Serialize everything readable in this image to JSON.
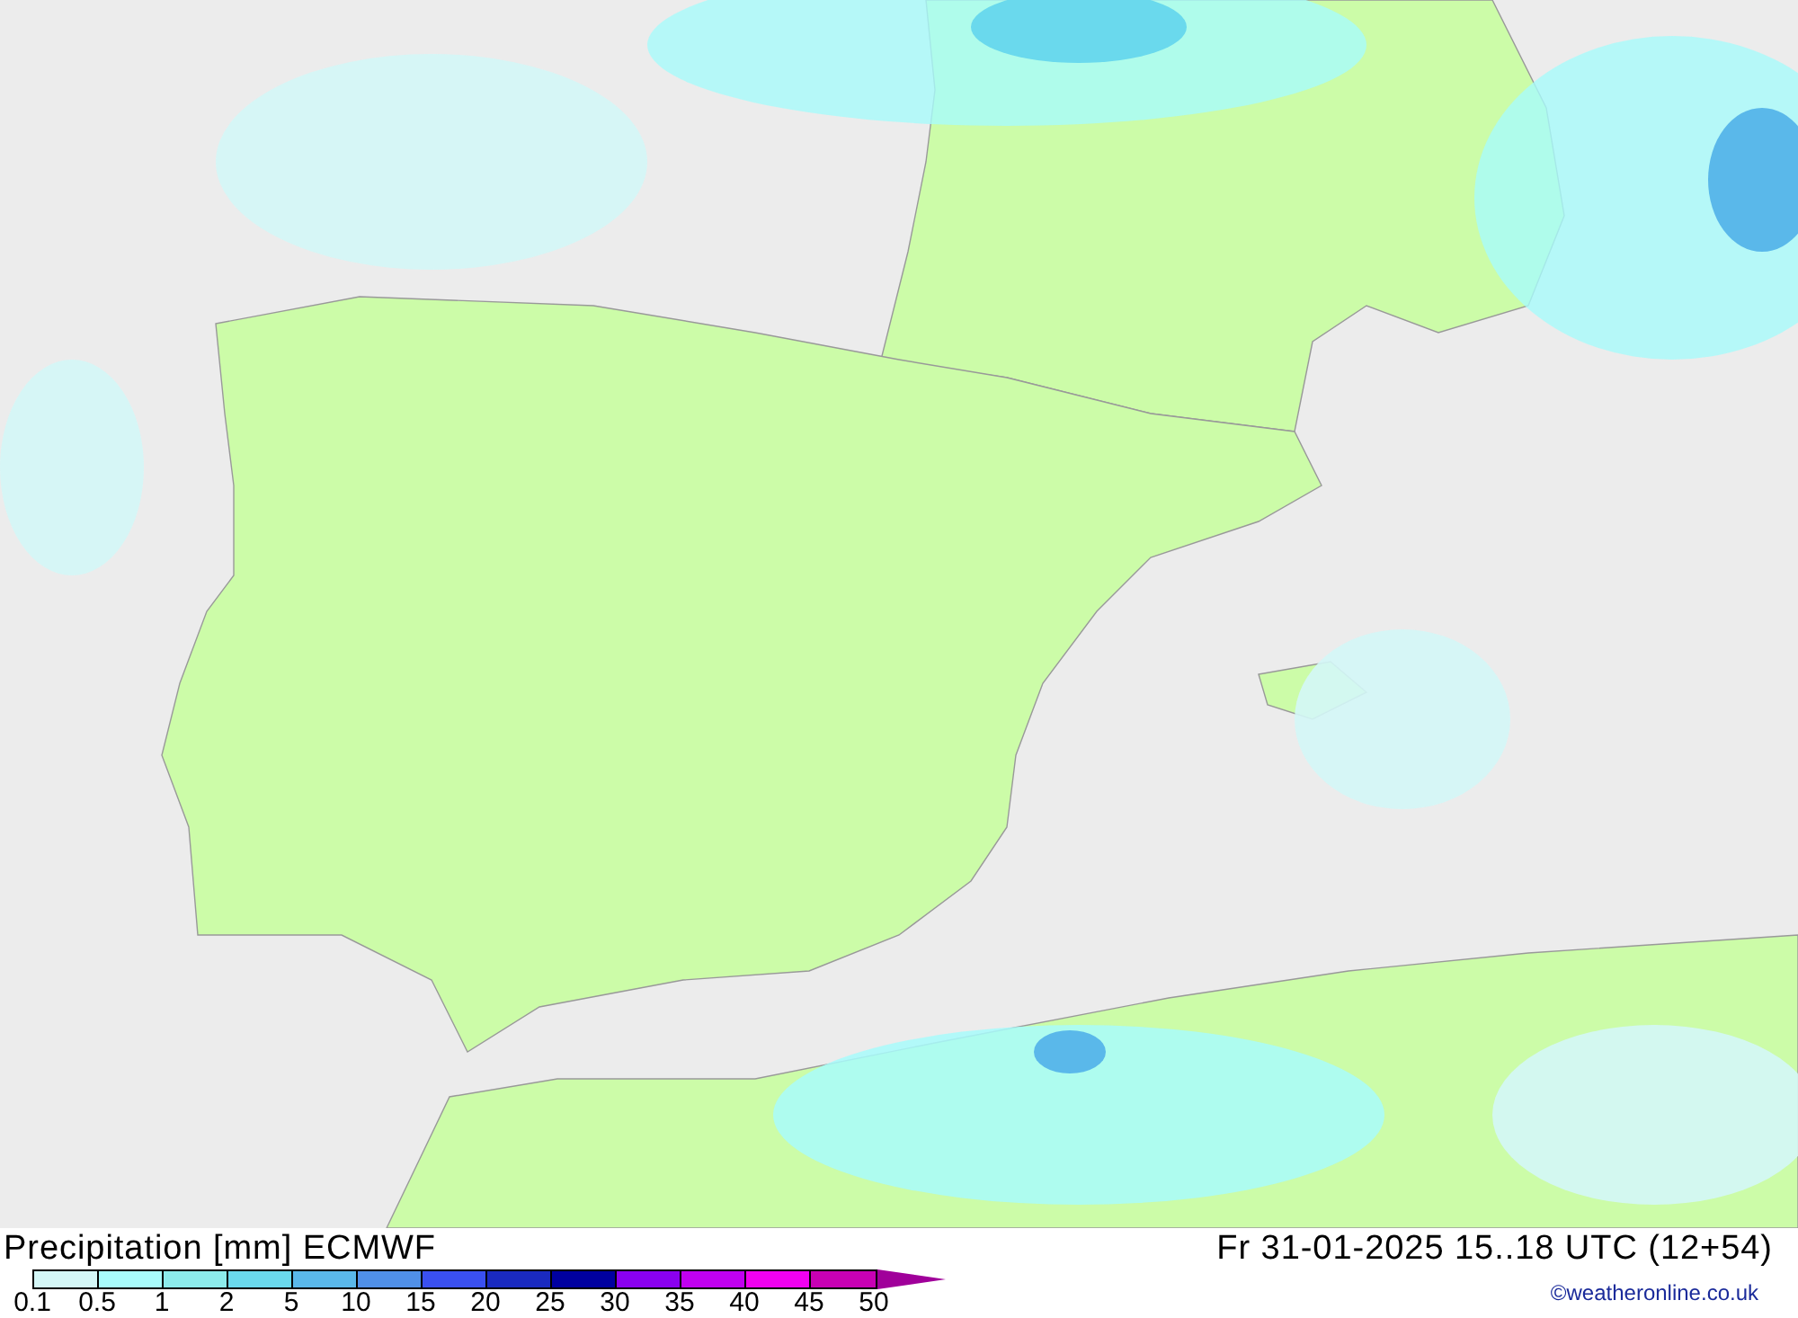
{
  "map": {
    "title": "Precipitation [mm] ECMWF",
    "valid_time": "Fr 31-01-2025 15..18 UTC (12+54)"
  },
  "legend": {
    "bins": [
      {
        "color": "#d4f7f7"
      },
      {
        "color": "#a8fbfb"
      },
      {
        "color": "#8cebeb"
      },
      {
        "color": "#6ad9ed"
      },
      {
        "color": "#5ab8ea"
      },
      {
        "color": "#5090e8"
      },
      {
        "color": "#3a50f0"
      },
      {
        "color": "#1a2ac0"
      },
      {
        "color": "#0000a0"
      },
      {
        "color": "#8a00f0"
      },
      {
        "color": "#c000f0"
      },
      {
        "color": "#f000f0"
      },
      {
        "color": "#c800b4"
      },
      {
        "kind": "arrow",
        "color": "#a0009a"
      }
    ],
    "labels": [
      "0.1",
      "0.5",
      "1",
      "2",
      "5",
      "10",
      "15",
      "20",
      "25",
      "30",
      "35",
      "40",
      "45",
      "50"
    ]
  },
  "credit": "©weatheronline.co.uk"
}
